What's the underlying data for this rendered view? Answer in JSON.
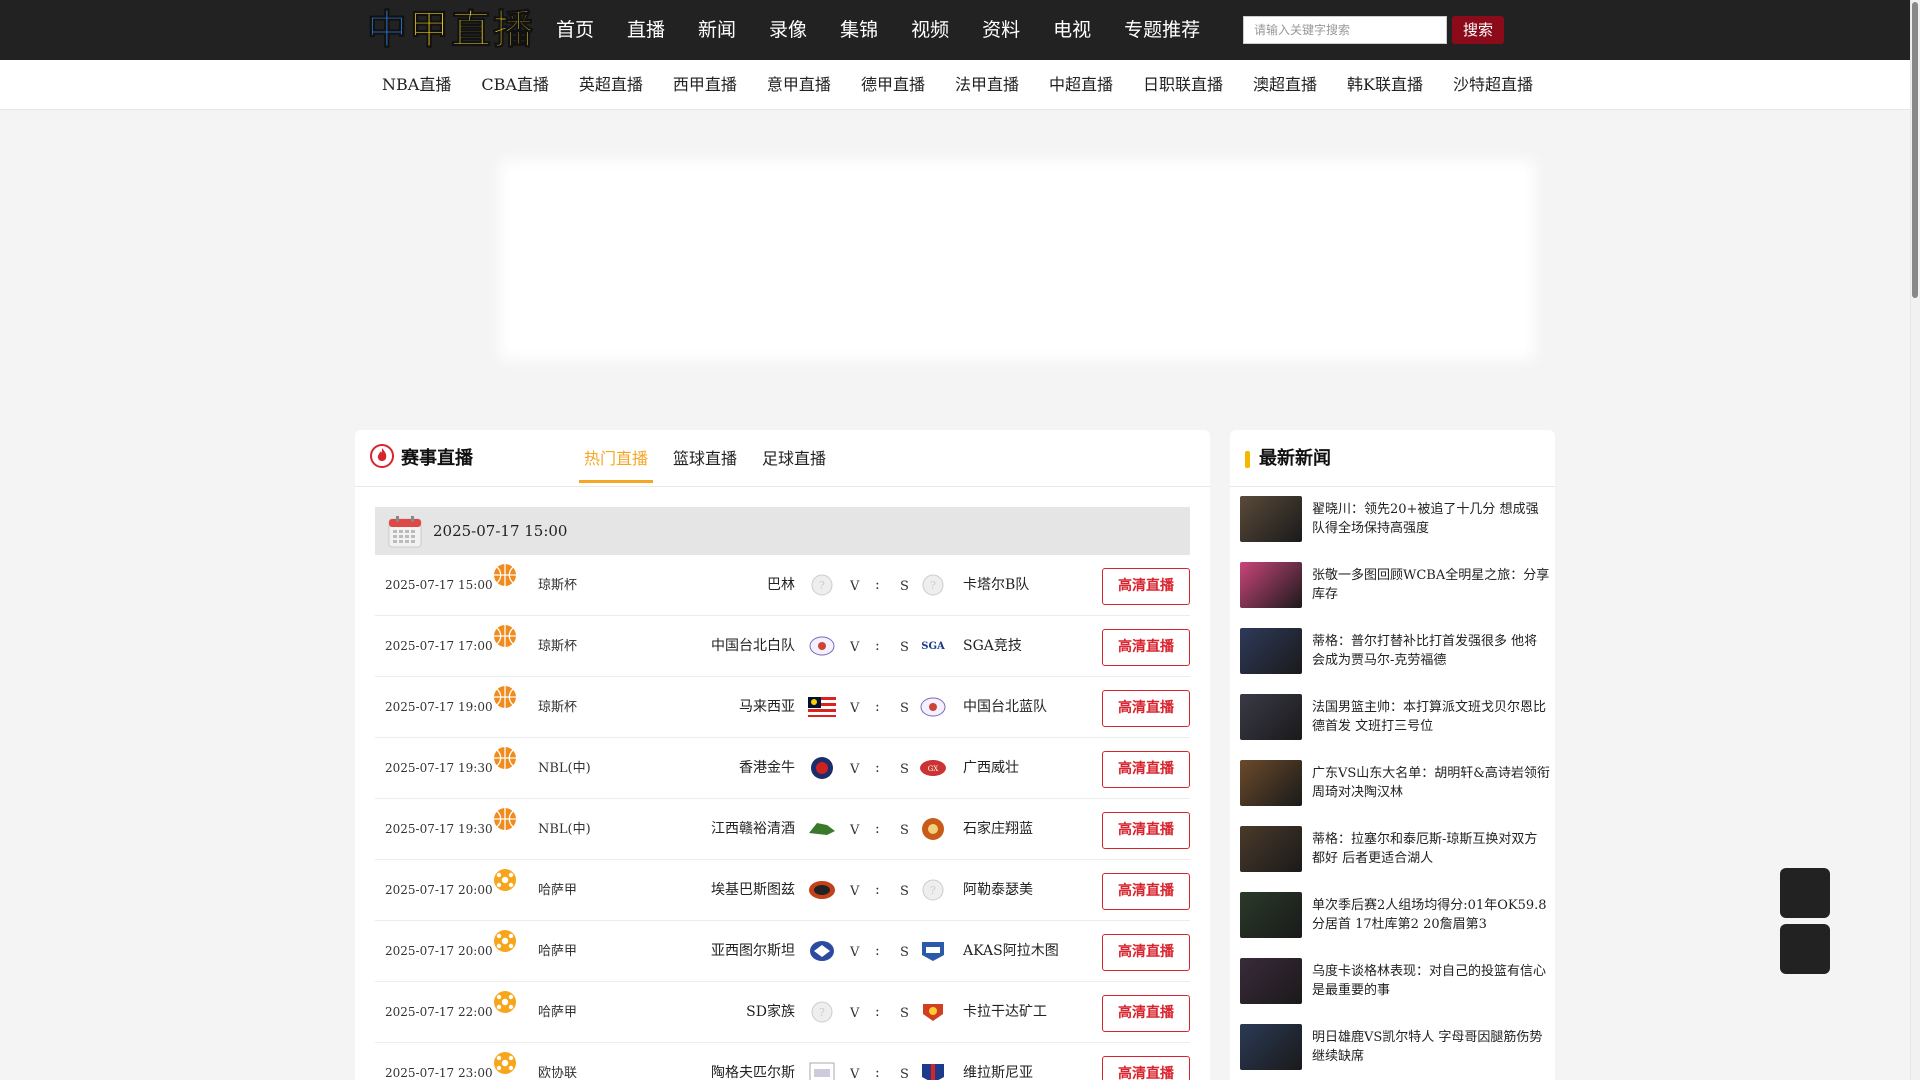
{
  "logo": {
    "chars": [
      "中",
      "甲",
      "直",
      "播"
    ]
  },
  "nav": {
    "items": [
      "首页",
      "直播",
      "新闻",
      "录像",
      "集锦",
      "视频",
      "资料",
      "电视",
      "专题推荐"
    ]
  },
  "search": {
    "placeholder": "请输入关键字搜索",
    "button": "搜索"
  },
  "subnav": {
    "items": [
      "NBA直播",
      "CBA直播",
      "英超直播",
      "西甲直播",
      "意甲直播",
      "德甲直播",
      "法甲直播",
      "中超直播",
      "日职联直播",
      "澳超直播",
      "韩K联直播",
      "沙特超直播"
    ]
  },
  "live": {
    "title": "赛事直播",
    "tabs": [
      "热门直播",
      "篮球直播",
      "足球直播"
    ],
    "date": "2025-07-17 15:00",
    "v": "V",
    "colon": ":",
    "s": "S",
    "btn": "高清直播",
    "matches": [
      {
        "time": "2025-07-17 15:00",
        "sport": "basketball",
        "league": "琼斯杯",
        "home": "巴林",
        "away": "卡塔尔B队",
        "home_logo": "placeholder",
        "away_logo": "placeholder"
      },
      {
        "time": "2025-07-17 17:00",
        "sport": "basketball",
        "league": "琼斯杯",
        "home": "中国台北白队",
        "away": "SGA竞技",
        "home_logo": "ctba",
        "away_logo": "sga"
      },
      {
        "time": "2025-07-17 19:00",
        "sport": "basketball",
        "league": "琼斯杯",
        "home": "马来西亚",
        "away": "中国台北蓝队",
        "home_logo": "malaysia",
        "away_logo": "ctba"
      },
      {
        "time": "2025-07-17 19:30",
        "sport": "basketball",
        "league": "NBL(中)",
        "home": "香港金牛",
        "away": "广西威壮",
        "home_logo": "hk",
        "away_logo": "gx"
      },
      {
        "time": "2025-07-17 19:30",
        "sport": "basketball",
        "league": "NBL(中)",
        "home": "江西赣裕清酒",
        "away": "石家庄翔蓝",
        "home_logo": "jx",
        "away_logo": "sjz"
      },
      {
        "time": "2025-07-17 20:00",
        "sport": "football",
        "league": "哈萨甲",
        "home": "埃基巴斯图兹",
        "away": "阿勒泰瑟美",
        "home_logo": "ekb",
        "away_logo": "placeholder"
      },
      {
        "time": "2025-07-17 20:00",
        "sport": "football",
        "league": "哈萨甲",
        "home": "亚西图尔斯坦",
        "away": "AKAS阿拉木图",
        "home_logo": "yxt",
        "away_logo": "akas"
      },
      {
        "time": "2025-07-17 22:00",
        "sport": "football",
        "league": "哈萨甲",
        "home": "SD家族",
        "away": "卡拉干达矿工",
        "home_logo": "placeholder",
        "away_logo": "klgd"
      },
      {
        "time": "2025-07-17 23:00",
        "sport": "football",
        "league": "欧协联",
        "home": "陶格夫匹尔斯",
        "away": "维拉斯尼亚",
        "home_logo": "tg",
        "away_logo": "wl"
      }
    ]
  },
  "news": {
    "title": "最新新闻",
    "items": [
      {
        "text": "翟晓川：领先20+被追了十几分 想成强队得全场保持高强度",
        "thumb": "#5a4a3a"
      },
      {
        "text": "张敬一多图回顾WCBA全明星之旅：分享库存",
        "thumb": "#c9457a"
      },
      {
        "text": "蒂格：普尔打替补比打首发强很多 他将会成为贾马尔-克劳福德",
        "thumb": "#2d3a5a"
      },
      {
        "text": "法国男篮主帅：本打算派文班戈贝尔恩比德首发 文班打三号位",
        "thumb": "#3a3a48"
      },
      {
        "text": "广东VS山东大名单：胡明轩&高诗岩领衔 周琦对决陶汉林",
        "thumb": "#6a4a2a"
      },
      {
        "text": "蒂格：拉塞尔和泰厄斯-琼斯互换对双方都好 后者更适合湖人",
        "thumb": "#4a3a2a"
      },
      {
        "text": "单次季后赛2人组场均得分:01年OK59.8分居首 17杜库第2 20詹眉第3",
        "thumb": "#2a3a2a"
      },
      {
        "text": "乌度卡谈格林表现：对自己的投篮有信心是最重要的事",
        "thumb": "#3a2a3a"
      },
      {
        "text": "明日雄鹿VS凯尔特人 字母哥因腿筋伤势继续缺席",
        "thumb": "#2a3a55"
      }
    ]
  },
  "colors": {
    "accent": "#f5a623",
    "button_red": "#d9232d",
    "topbar": "#222222",
    "search_btn": "#8b0b1a"
  }
}
